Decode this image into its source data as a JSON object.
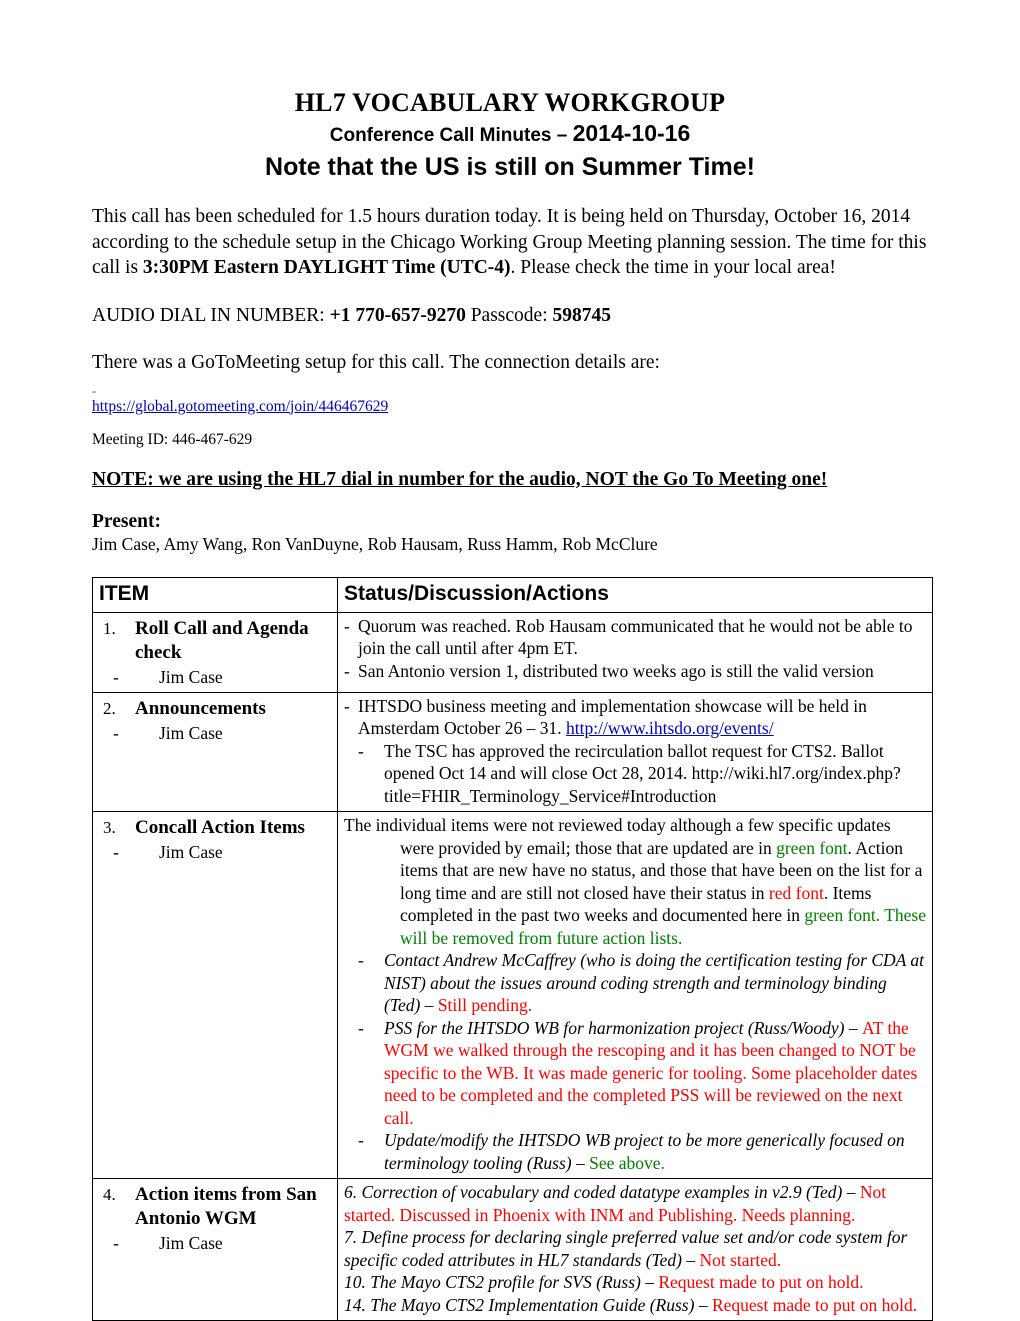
{
  "header": {
    "title": "HL7 VOCABULARY WORKGROUP",
    "subtitle_prefix": "Conference Call Minutes – ",
    "subtitle_date": "2014-10-16",
    "banner": "Note that the US is still on Summer Time!"
  },
  "intro": {
    "line1": "This call has been scheduled for 1.5 hours duration today.  It is being held on Thursday, October 16, 2014 according to the schedule setup in the Chicago Working Group Meeting planning session.  The time for this call is ",
    "bold_time": "3:30PM Eastern DAYLIGHT Time (UTC-4)",
    "line2": ". Please check the time in your local area!"
  },
  "dial_in": {
    "label": "AUDIO DIAL IN NUMBER:  ",
    "number": "+1 770-657-9270",
    "passcode_label": " Passcode:  ",
    "passcode": "598745"
  },
  "gotomeeting": {
    "intro": "There was a GoToMeeting setup for this call.  The connection details are:",
    "dash": "-",
    "url": "https://global.gotomeeting.com/join/446467629",
    "meeting_id": "Meeting ID: 446-467-629",
    "note": "NOTE:  we are using the HL7 dial in number for the audio, NOT the Go To Meeting one!"
  },
  "present": {
    "label": "Present:",
    "names": "Jim Case, Amy Wang, Ron VanDuyne, Rob Hausam, Russ Hamm, Rob McClure"
  },
  "table": {
    "headers": {
      "item": "ITEM",
      "status": "Status/Discussion/Actions"
    },
    "rows": [
      {
        "num": "1.",
        "title": "Roll Call and Agenda check",
        "owner_dash": "-",
        "owner": "Jim Case",
        "status": {
          "b1_dash": "-",
          "b1": "Quorum was reached.  Rob Hausam communicated that he would not be able to join the call until after 4pm ET.",
          "b2_dash": "-",
          "b2": "San Antonio version 1, distributed two weeks ago is still the valid version"
        }
      },
      {
        "num": "2.",
        "title": "Announcements",
        "owner_dash": "-",
        "owner": "Jim Case",
        "status": {
          "b1_dash": "-",
          "b1": "IHTSDO business meeting and implementation showcase will be held in Amsterdam October 26 – 31.  ",
          "b1_link": "http://www.ihtsdo.org/events/",
          "b2_dash": "-",
          "b2": "The TSC has approved the recirculation ballot request for CTS2. Ballot opened Oct 14 and will close Oct 28, 2014. http://wiki.hl7.org/index.php?title=FHIR_Terminology_Service#Introduction"
        }
      },
      {
        "num": "3.",
        "title": "Concall Action Items",
        "owner_dash": "-",
        "owner": "Jim Case",
        "status": {
          "p1_a": "The individual items were not reviewed today although a few specific updates were provided by email; those that are updated are in ",
          "p1_green1": "green font",
          "p1_b": ".  Action items that are new have no status, and those that have been on the list for a long time and are still not closed have their status in ",
          "p1_red1": "red font",
          "p1_c": ".  Items completed in the past two weeks and documented here in ",
          "p1_green2": "green font.  These will be removed from future action lists.",
          "b1_dash": "-",
          "b1_italic": "Contact Andrew McCaffrey (who is doing the certification testing for CDA at NIST) about the issues around coding strength and terminology binding (Ted) – ",
          "b1_red": "Still pending.",
          "b2_dash": "-",
          "b2_italic": "PSS for the IHTSDO WB for harmonization project (Russ/Woody) – ",
          "b2_red": "AT the WGM we walked through the rescoping and it has been changed to NOT be specific to the WB.  It was made generic for tooling.  Some placeholder dates need to be completed and the completed PSS will be reviewed on the next call.",
          "b3_dash": "-",
          "b3_italic": "Update/modify the IHTSDO WB project to be more generically focused on terminology tooling (Russ) – ",
          "b3_green": "See above."
        }
      },
      {
        "num": "4.",
        "title": "Action items from San Antonio WGM",
        "owner_dash": "-",
        "owner": "Jim Case",
        "status": {
          "i1_italic": "6.  Correction of vocabulary and coded datatype examples in v2.9 (Ted) – ",
          "i1_red": "Not started.  Discussed in Phoenix with INM and Publishing.  Needs planning.",
          "i2_italic": "7.  Define process for declaring single preferred value set and/or code system for specific coded attributes in HL7 standards (Ted) – ",
          "i2_red": "Not started.",
          "i3_italic": "10.  The Mayo CTS2 profile for SVS (Russ) – ",
          "i3_red": "Request made to put on hold.",
          "i4_italic": "14.  The Mayo CTS2 Implementation Guide (Russ) – ",
          "i4_red": "Request made to put on hold."
        }
      }
    ]
  },
  "colors": {
    "green": "#008000",
    "red": "#ff0000",
    "link": "#0000c0"
  }
}
